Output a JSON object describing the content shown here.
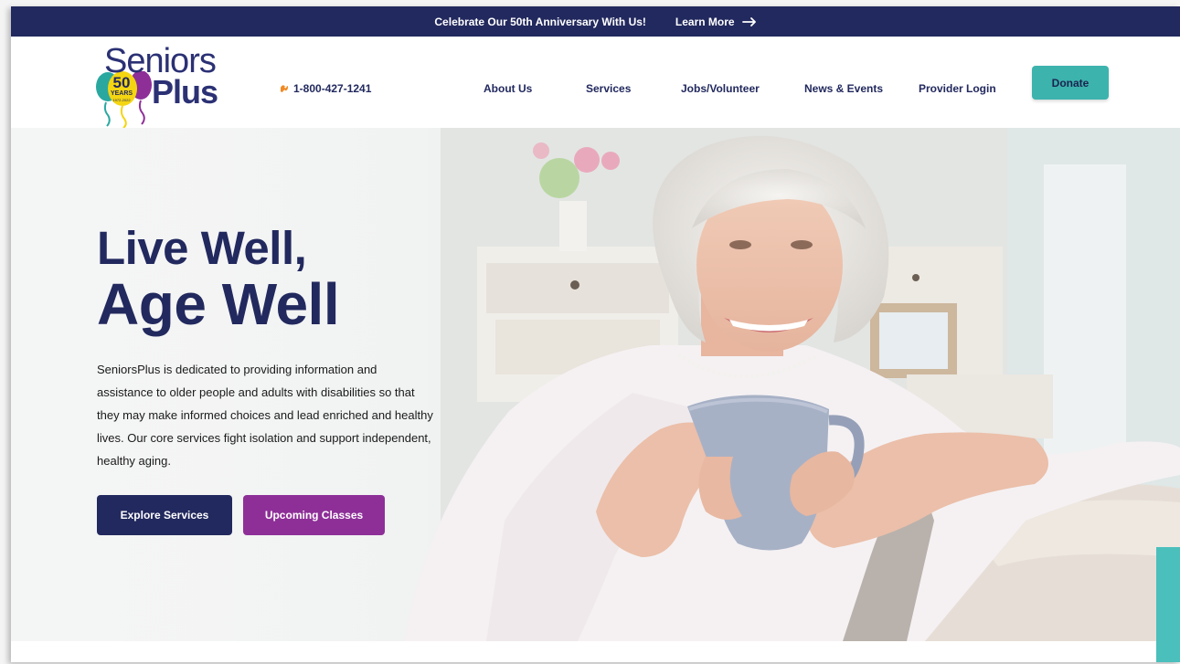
{
  "announcement": {
    "message": "Celebrate Our 50th Anniversary With Us!",
    "link_label": "Learn More",
    "arrow_icon": "arrow-right-icon"
  },
  "logo": {
    "word1": "Seniors",
    "word2": "Plus",
    "badge_number": "50",
    "badge_label": "YEARS",
    "badge_dates": "1972-2022"
  },
  "header": {
    "phone": "1-800-427-1241",
    "phone_icon": "phone-icon",
    "nav": [
      "About Us",
      "Services",
      "Jobs/Volunteer",
      "News & Events",
      "Provider Login"
    ],
    "donate_label": "Donate"
  },
  "hero": {
    "title_line1": "Live Well,",
    "title_line2": "Age Well",
    "description": "SeniorsPlus is dedicated to providing information and assistance to older people and adults with disabilities so that they may make informed choices and lead enriched and healthy lives. Our core services fight isolation and support independent, healthy aging.",
    "primary_button": "Explore Services",
    "secondary_button": "Upcoming Classes"
  },
  "colors": {
    "navy": "#22295e",
    "teal": "#3cb3ad",
    "purple": "#8e2f98",
    "balloon_yellow": "#f4d511",
    "balloon_teal": "#2aa8a0",
    "balloon_purple": "#8e2f98"
  }
}
